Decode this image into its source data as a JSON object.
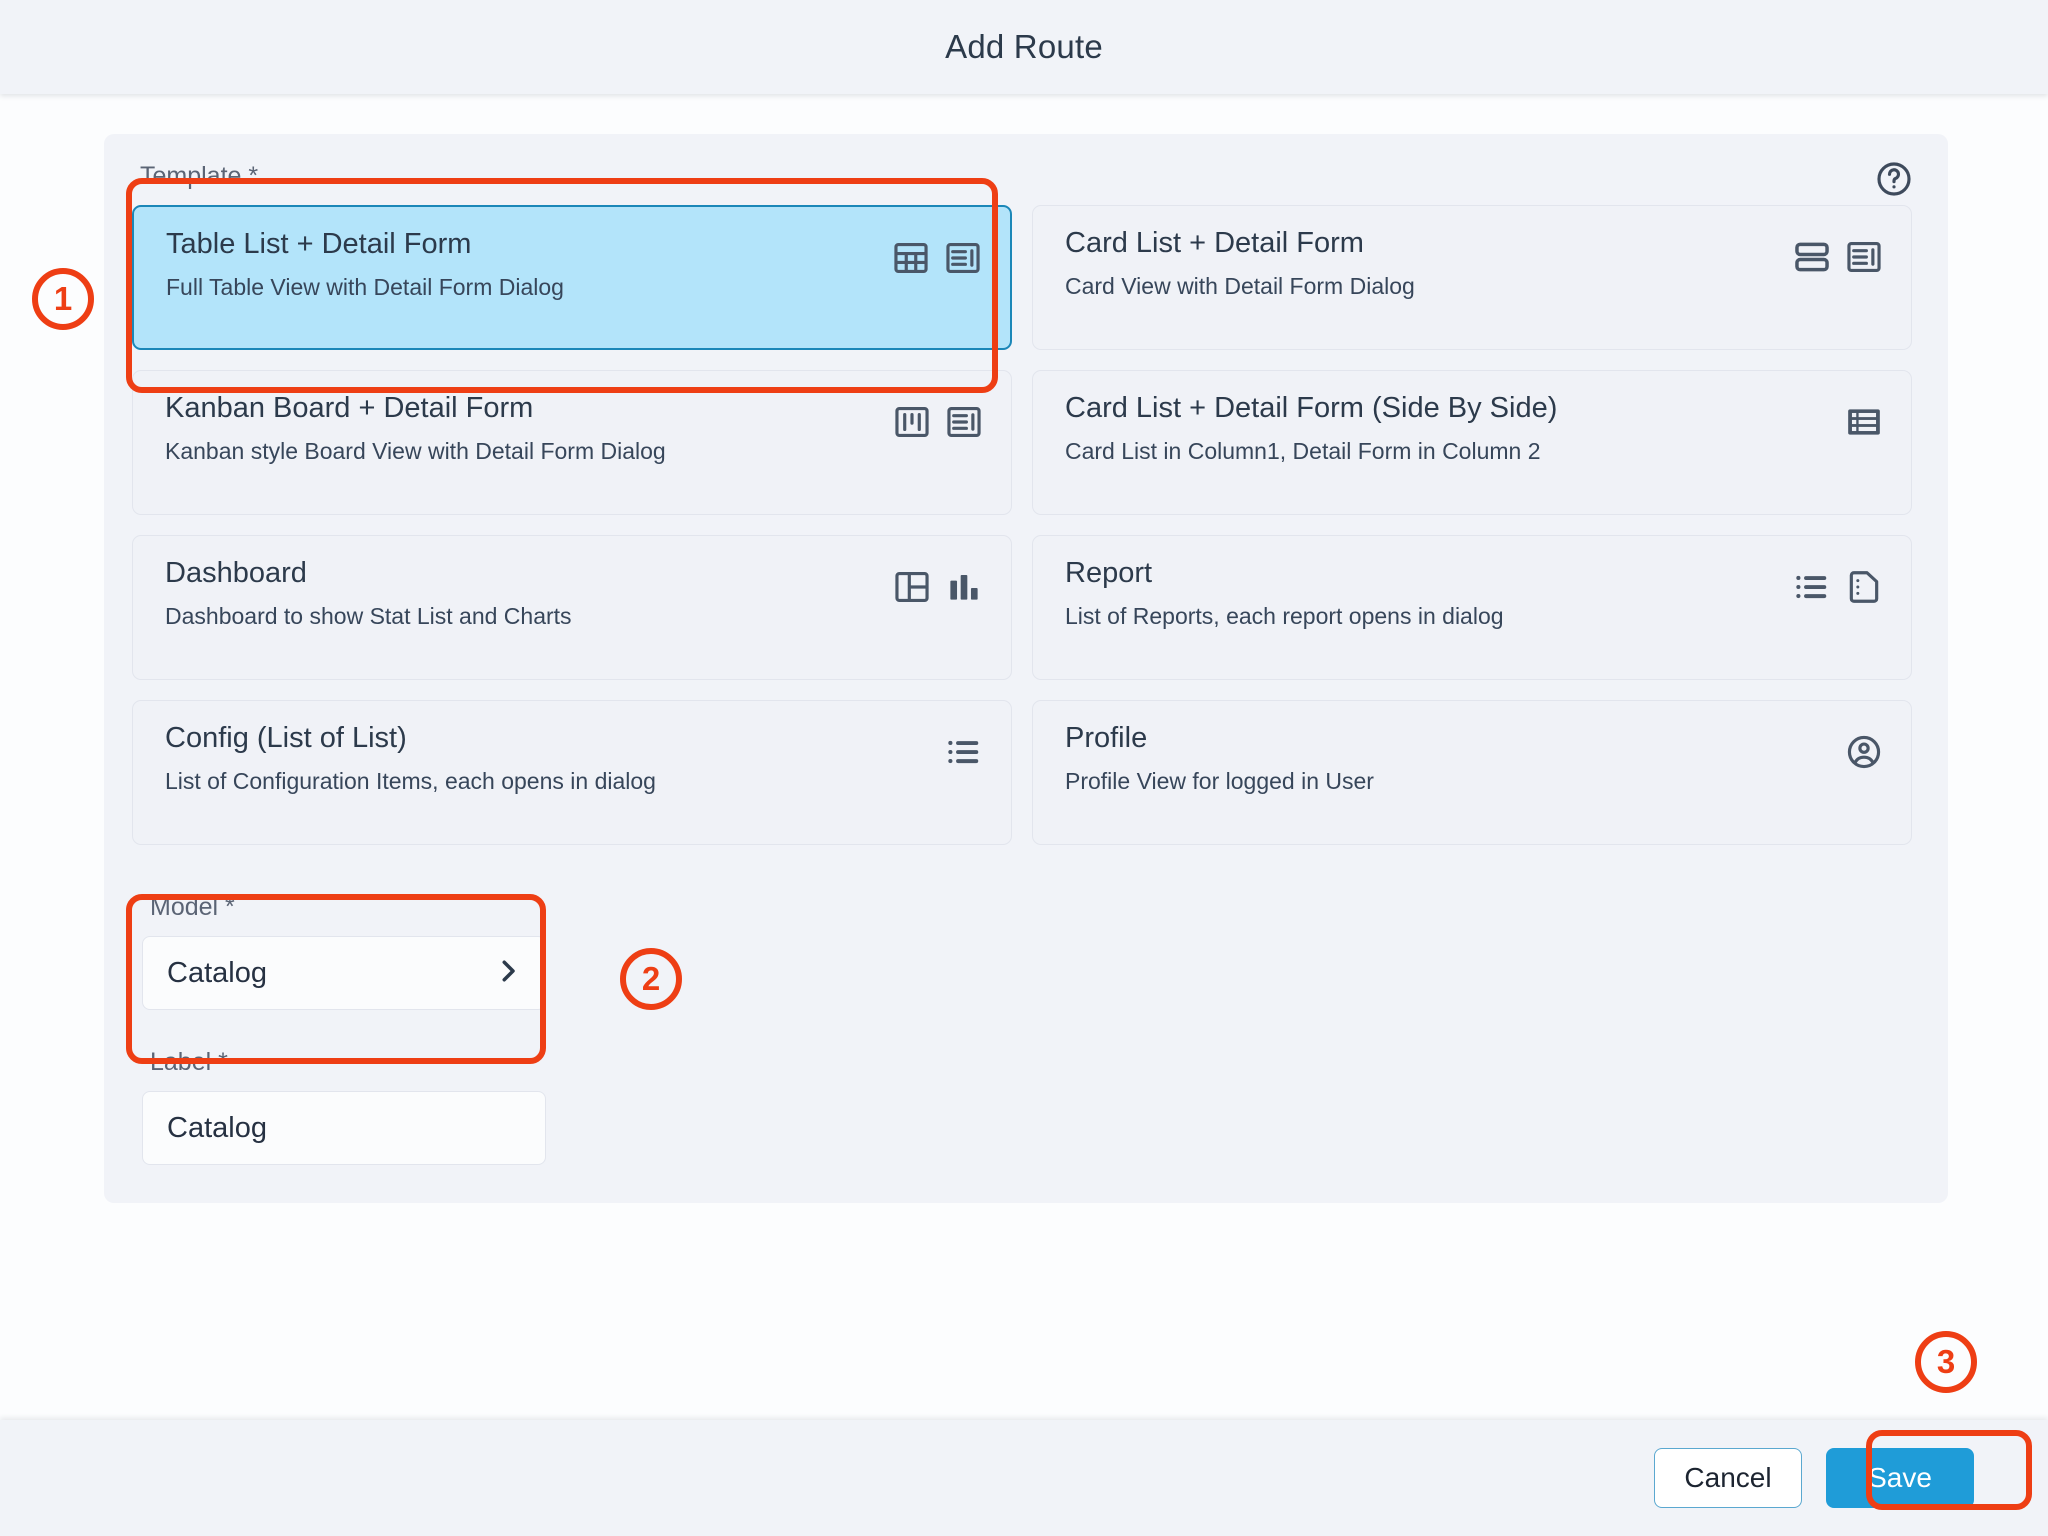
{
  "header": {
    "title": "Add Route"
  },
  "form": {
    "template_label": "Template *",
    "model_label": "Model *",
    "label_label": "Label *",
    "model_value": "Catalog",
    "label_value": "Catalog",
    "label_placeholder": "Label",
    "help_icon": "help-circle-icon",
    "chevron_icon": "chevron-right-icon"
  },
  "templates": [
    {
      "title": "Table List + Detail Form",
      "desc": "Full Table View with Detail Form Dialog",
      "selected": true,
      "icons": [
        "table-grid-icon",
        "detail-form-icon"
      ]
    },
    {
      "title": "Card List + Detail Form",
      "desc": "Card View with Detail Form Dialog",
      "selected": false,
      "icons": [
        "stacked-cards-icon",
        "detail-form-icon"
      ]
    },
    {
      "title": "Kanban Board + Detail Form",
      "desc": "Kanban style Board View with Detail Form Dialog",
      "selected": false,
      "icons": [
        "kanban-board-icon",
        "detail-form-icon"
      ]
    },
    {
      "title": "Card List + Detail Form (Side By Side)",
      "desc": "Card List in Column1, Detail Form in Column 2",
      "selected": false,
      "icons": [
        "filled-list-icon"
      ]
    },
    {
      "title": "Dashboard",
      "desc": "Dashboard to show Stat List and Charts",
      "selected": false,
      "icons": [
        "layout-panel-icon",
        "bar-chart-icon"
      ]
    },
    {
      "title": "Report",
      "desc": "List of Reports, each report opens in dialog",
      "selected": false,
      "icons": [
        "bulleted-list-icon",
        "document-icon"
      ]
    },
    {
      "title": "Config (List of List)",
      "desc": "List of Configuration Items, each opens in dialog",
      "selected": false,
      "icons": [
        "bulleted-list-icon"
      ]
    },
    {
      "title": "Profile",
      "desc": "Profile View for logged in User",
      "selected": false,
      "icons": [
        "account-circle-icon"
      ]
    }
  ],
  "footer": {
    "cancel_label": "Cancel",
    "save_label": "Save"
  },
  "annotations": {
    "step1": "1",
    "step2": "2",
    "step3": "3",
    "color": "#ee3e14"
  }
}
